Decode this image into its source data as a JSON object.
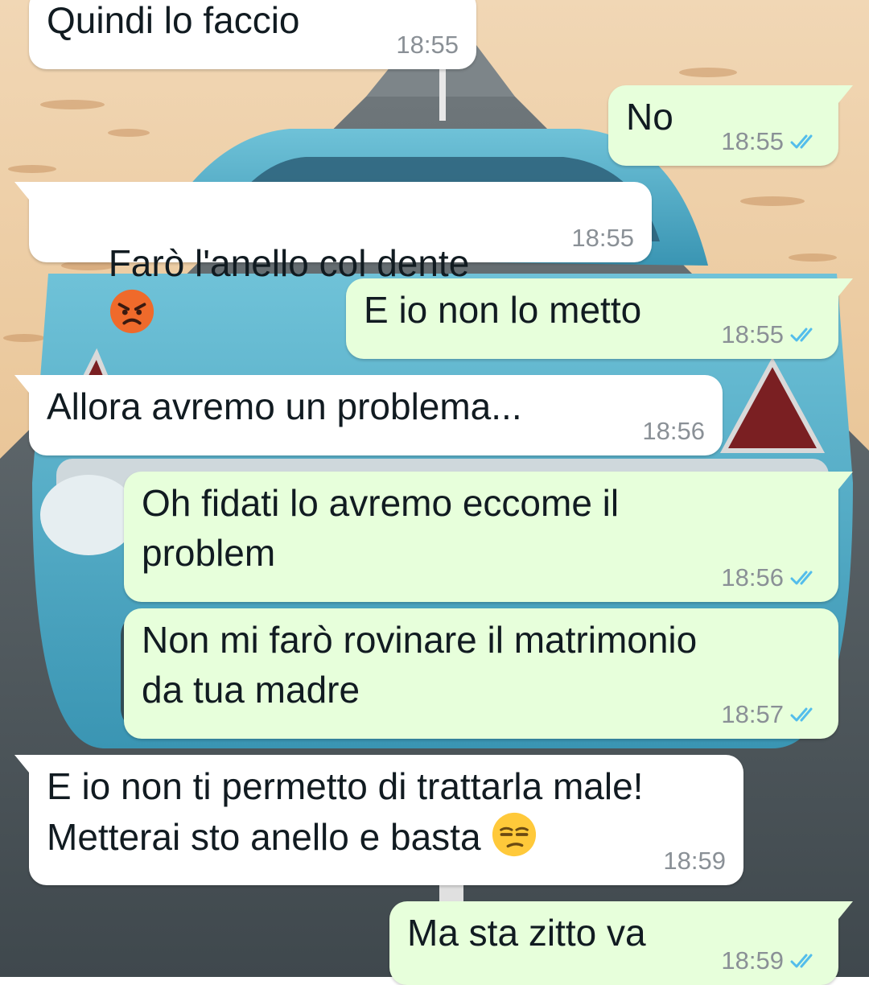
{
  "colors": {
    "incoming_bubble": "#ffffff",
    "outgoing_bubble": "#e7ffdb",
    "timestamp": "#8a9096",
    "read_ticks": "#53bdeb"
  },
  "wallpaper": {
    "description_icon": "vintage-car-desert-road-wallpaper"
  },
  "messages": [
    {
      "direction": "in",
      "text": "Quindi lo faccio",
      "time": "18:55"
    },
    {
      "direction": "out",
      "text": "No",
      "time": "18:55",
      "status": "read"
    },
    {
      "direction": "in",
      "text": "Farò l'anello col dente",
      "emoji": "angry-face-icon",
      "time": "18:55"
    },
    {
      "direction": "out",
      "text": "E io non lo metto",
      "time": "18:55",
      "status": "read"
    },
    {
      "direction": "in",
      "text": "Allora avremo un problema...",
      "time": "18:56"
    },
    {
      "direction": "out",
      "text": "Oh fidati lo avremo eccome il\nproblem",
      "time": "18:56",
      "status": "read"
    },
    {
      "direction": "out",
      "text": "Non mi farò rovinare il matrimonio\nda tua madre",
      "time": "18:57",
      "status": "read"
    },
    {
      "direction": "in",
      "text": "E io non ti permetto di trattarla male!\nMetterai sto anello e basta",
      "emoji": "unamused-face-icon",
      "time": "18:59"
    },
    {
      "direction": "out",
      "text": "Ma sta zitto va",
      "time": "18:59",
      "status": "read"
    }
  ]
}
